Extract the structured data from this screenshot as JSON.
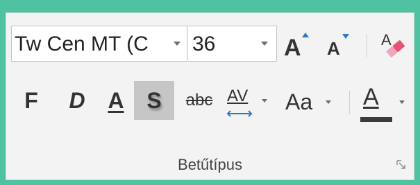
{
  "font_group": {
    "font_name": "Tw Cen MT (C",
    "font_size": "36",
    "bold_label": "F",
    "italic_label": "D",
    "underline_label": "A",
    "shadow_label": "S",
    "strikethrough_label": "abc",
    "char_spacing_label": "AV",
    "change_case_label": "Aa",
    "font_color_label": "A",
    "group_title": "Betűtípus"
  },
  "colors": {
    "accent_blue": "#2b79c7",
    "background_teal": "#4fc3a1",
    "pressed_gray": "#c6c6c6",
    "font_color_bar": "#3b3b3b"
  },
  "icons": {
    "grow": "grow-font-icon",
    "shrink": "shrink-font-icon",
    "clear": "clear-formatting-icon",
    "launcher": "dialog-launcher-icon"
  }
}
